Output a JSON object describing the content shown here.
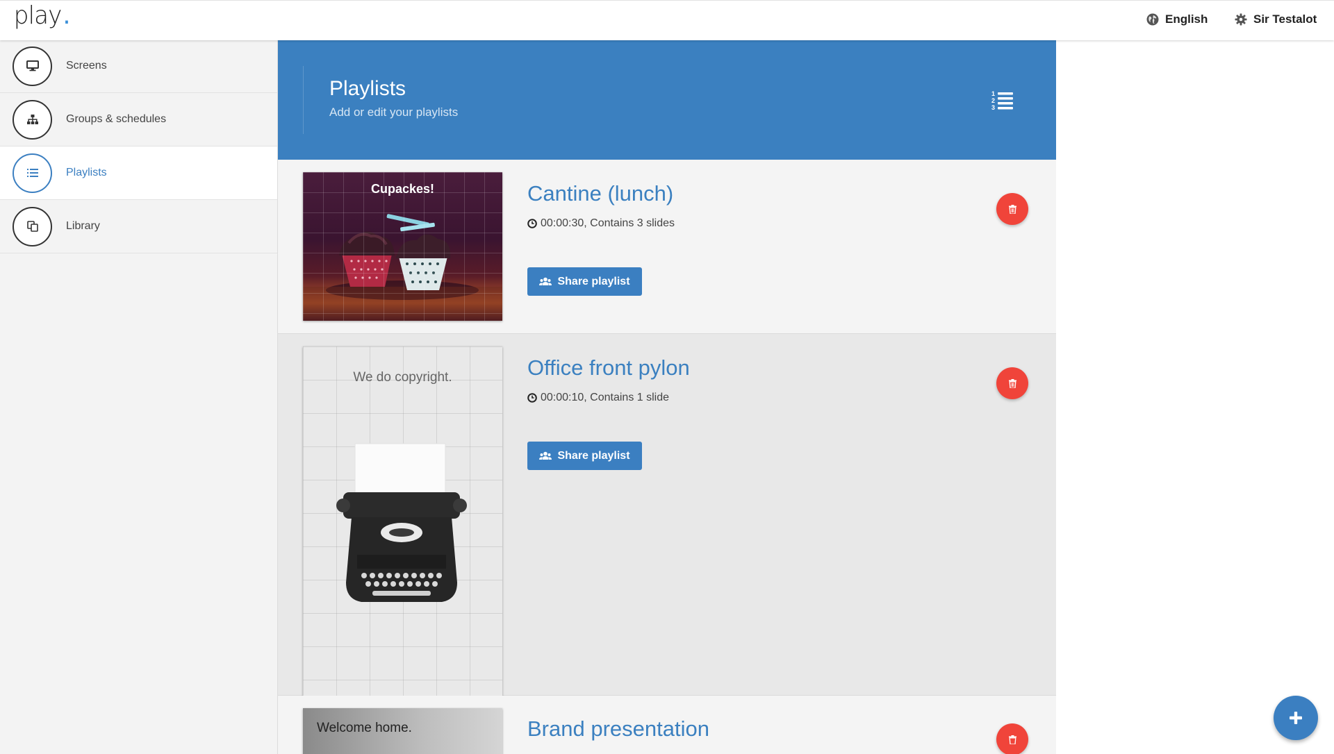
{
  "app": {
    "logo_text": "play",
    "logo_dot": ".",
    "brand_color": "#3b80c0",
    "danger_color": "#f0443a"
  },
  "topbar": {
    "language_label": "English",
    "language_icon": "globe-icon",
    "user_label": "Sir Testalot",
    "user_icon": "gear-icon"
  },
  "sidebar": {
    "items": [
      {
        "label": "Screens",
        "icon": "monitor-icon",
        "active": false
      },
      {
        "label": "Groups & schedules",
        "icon": "sitemap-icon",
        "active": false
      },
      {
        "label": "Playlists",
        "icon": "list-icon",
        "active": true
      },
      {
        "label": "Library",
        "icon": "copy-icon",
        "active": false
      }
    ]
  },
  "header": {
    "title": "Playlists",
    "subtitle": "Add or edit your playlists",
    "icon": "ordered-list-icon"
  },
  "playlists": [
    {
      "title": "Cantine (lunch)",
      "duration": "00:00:30",
      "slides_text": ", Contains 3 slides",
      "thumb_caption": "Cupackes!",
      "share_label": "Share playlist"
    },
    {
      "title": "Office front pylon",
      "duration": "00:00:10",
      "slides_text": ", Contains 1 slide",
      "thumb_caption": "We do copyright.",
      "share_label": "Share playlist"
    },
    {
      "title": "Brand presentation",
      "thumb_caption": "Welcome home."
    }
  ],
  "fab": {
    "icon": "plus-icon"
  }
}
